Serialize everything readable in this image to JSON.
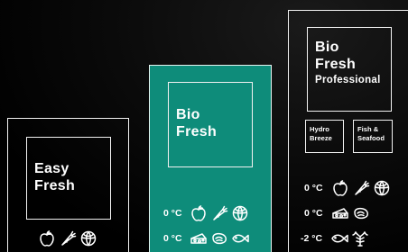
{
  "easy_fresh": {
    "title_line1": "Easy",
    "title_line2": "Fresh",
    "icons": [
      "apple-icon",
      "carrot-icon",
      "cabbage-icon"
    ]
  },
  "bio_fresh": {
    "title_line1": "Bio",
    "title_line2": "Fresh",
    "accent_color": "#0e8c7a",
    "rows": [
      {
        "temp": "0 °C",
        "icons": [
          "apple-icon",
          "carrot-icon",
          "cabbage-icon"
        ]
      },
      {
        "temp": "0 °C",
        "icons": [
          "cheese-icon",
          "meat-icon",
          "fish-icon"
        ]
      }
    ]
  },
  "bio_fresh_professional": {
    "title_line1": "Bio",
    "title_line2": "Fresh",
    "title_line3": "Professional",
    "subzones": [
      {
        "line1": "Hydro",
        "line2": "Breeze"
      },
      {
        "line1": "Fish &",
        "line2": "Seafood"
      }
    ],
    "rows": [
      {
        "temp": "0 °C",
        "icons": [
          "apple-icon",
          "carrot-icon",
          "cabbage-icon"
        ]
      },
      {
        "temp": "0 °C",
        "icons": [
          "cheese-icon",
          "meat-icon"
        ]
      },
      {
        "temp": "-2 °C",
        "icons": [
          "fish-icon",
          "shellfish-icon"
        ]
      }
    ]
  }
}
